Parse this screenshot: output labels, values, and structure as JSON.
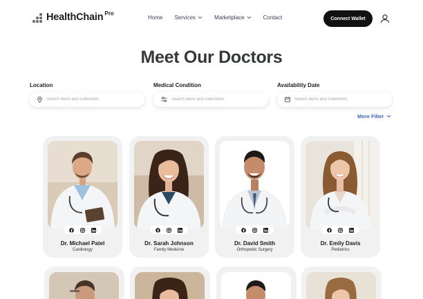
{
  "header": {
    "brand": "HealthChain",
    "brand_sup": "Pro",
    "nav": [
      {
        "label": "Home",
        "has_dropdown": false
      },
      {
        "label": "Services",
        "has_dropdown": true
      },
      {
        "label": "Marketplace",
        "has_dropdown": true
      },
      {
        "label": "Contact",
        "has_dropdown": false
      }
    ],
    "connect_label": "Connect Wallet",
    "user_icon": "user-icon"
  },
  "title": "Meet Our Doctors",
  "filters": [
    {
      "label": "Location",
      "placeholder": "Search items and collections",
      "icon": "location-pin-icon"
    },
    {
      "label": "Medical Condition",
      "placeholder": "Search items and collections",
      "icon": "sliders-icon"
    },
    {
      "label": "Availability Date",
      "placeholder": "Search items and collections",
      "icon": "calendar-icon"
    }
  ],
  "more_filter": "More Filter",
  "doctors": [
    {
      "name": "Dr. Michael Patel",
      "specialty": "Cardiology"
    },
    {
      "name": "Dr. Sarah Johnson",
      "specialty": "Family Medicine"
    },
    {
      "name": "Dr. David Smith",
      "specialty": "Orthopedic Surgery"
    },
    {
      "name": "Dr. Emily Davis",
      "specialty": "Pediatrics"
    }
  ],
  "social_icons": [
    "facebook-icon",
    "instagram-icon",
    "linkedin-icon"
  ],
  "colors": {
    "accent_link": "#3d63b9",
    "button": "#111111",
    "card_bg": "#f1f1f1",
    "title": "#333a35"
  }
}
